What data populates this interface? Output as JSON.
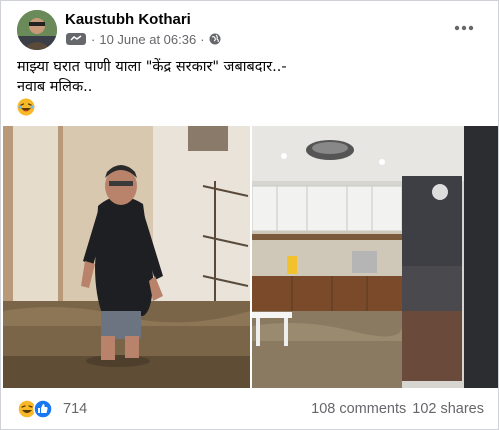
{
  "post": {
    "author": "Kaustubh Kothari",
    "date": "10 June at 06:36",
    "separator": "·",
    "text_line1": "माझ्या घरात पाणी याला \"केंद्र सरकार\" जबाबदार..-",
    "text_line2": "नवाब मलिक.."
  },
  "footer": {
    "reaction_count": "714",
    "comments": "108 comments",
    "shares": "102 shares"
  },
  "colors": {
    "text_primary": "#050505",
    "text_secondary": "#65676b",
    "like_blue": "#1877f2",
    "haha_yellow": "#f7b928",
    "border": "#cfd2d6"
  },
  "icons": {
    "privacy": "globe-icon",
    "audience": "messenger-icon",
    "menu": "more-options-icon",
    "reactions": [
      "haha-reaction-icon",
      "like-reaction-icon"
    ]
  }
}
